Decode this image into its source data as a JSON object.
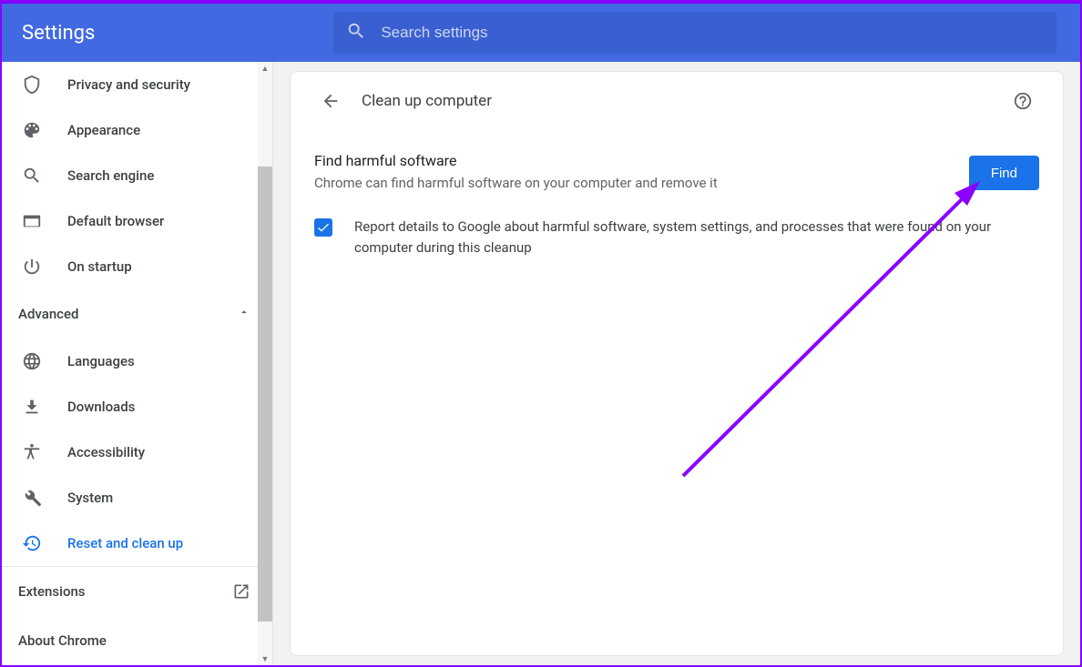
{
  "header": {
    "title": "Settings"
  },
  "search": {
    "placeholder": "Search settings"
  },
  "sidebar": {
    "items": [
      {
        "id": "privacy",
        "label": "Privacy and security"
      },
      {
        "id": "appearance",
        "label": "Appearance"
      },
      {
        "id": "search-engine",
        "label": "Search engine"
      },
      {
        "id": "default-browser",
        "label": "Default browser"
      },
      {
        "id": "on-startup",
        "label": "On startup"
      }
    ],
    "advanced_label": "Advanced",
    "advanced_items": [
      {
        "id": "languages",
        "label": "Languages"
      },
      {
        "id": "downloads",
        "label": "Downloads"
      },
      {
        "id": "accessibility",
        "label": "Accessibility"
      },
      {
        "id": "system",
        "label": "System"
      },
      {
        "id": "reset",
        "label": "Reset and clean up",
        "active": true
      }
    ],
    "footer": {
      "extensions": "Extensions",
      "about": "About Chrome"
    }
  },
  "page": {
    "title": "Clean up computer",
    "section": {
      "title": "Find harmful software",
      "subtitle": "Chrome can find harmful software on your computer and remove it",
      "button": "Find",
      "report_checked": true,
      "report_text": "Report details to Google about harmful software, system settings, and processes that were found on your computer during this cleanup"
    }
  },
  "annotation": {
    "color": "#8B00FF"
  }
}
